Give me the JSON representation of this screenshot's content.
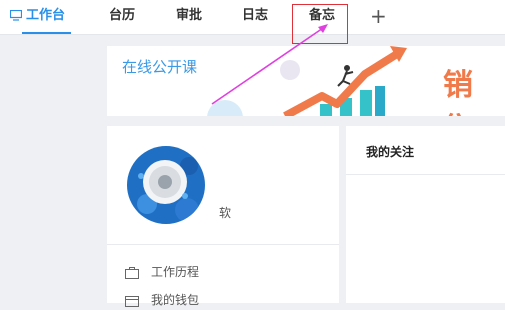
{
  "tabs": [
    {
      "label": "工作台",
      "active": true
    },
    {
      "label": "台历"
    },
    {
      "label": "审批"
    },
    {
      "label": "日志"
    },
    {
      "label": "备忘"
    },
    {
      "label": "+"
    }
  ],
  "banner": {
    "title": "在线公开课",
    "big_text": "销售"
  },
  "profile": {
    "name_suffix": "软"
  },
  "menu": [
    {
      "label": "工作历程"
    },
    {
      "label": "我的钱包"
    }
  ],
  "follow": {
    "title": "我的关注"
  },
  "colors": {
    "accent": "#2a8fe8",
    "annotation_red": "#e0303a",
    "annotation_magenta": "#e040e0",
    "banner_orange": "#f07a4a"
  }
}
